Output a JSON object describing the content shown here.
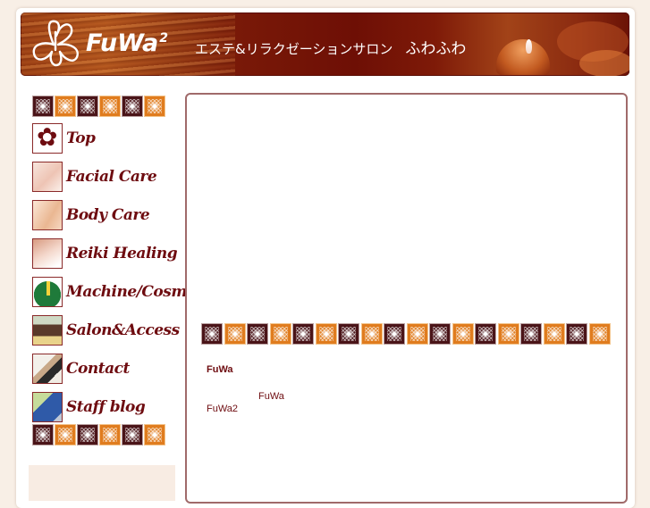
{
  "header": {
    "logo_text": "FuWa",
    "logo_superscript": "2",
    "tagline": "エステ&リラクゼーションサロン",
    "salon_name": "ふわふわ"
  },
  "sidebar": {
    "tile_pattern": [
      "dark",
      "orange",
      "dark",
      "orange",
      "dark",
      "orange"
    ],
    "items": [
      {
        "label": "Top",
        "icon": "hibiscus-icon"
      },
      {
        "label": "Facial Care",
        "icon": "face-photo-icon"
      },
      {
        "label": "Body Care",
        "icon": "body-photo-icon"
      },
      {
        "label": "Reiki Healing",
        "icon": "reiki-photo-icon"
      },
      {
        "label": "Machine/Cosme",
        "icon": "cosmetics-icon"
      },
      {
        "label": "Salon&Access",
        "icon": "salon-photo-icon"
      },
      {
        "label": "Contact",
        "icon": "contact-photo-icon"
      },
      {
        "label": "Staff blog",
        "icon": "blog-photo-icon"
      }
    ]
  },
  "main": {
    "heading": "FuWa",
    "line1": "FuWa",
    "line2": "FuWa2"
  },
  "colors": {
    "accent": "#6e0c10",
    "tile_dark": "#4a1418",
    "tile_orange": "#e07c1e",
    "background": "#f8efe6",
    "border": "#a06a6a"
  }
}
